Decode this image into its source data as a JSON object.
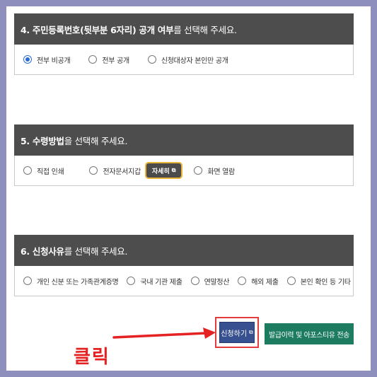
{
  "sections": [
    {
      "title_bold": "4. 주민등록번호(뒷부분 6자리) 공개 여부",
      "title_rest": "를 선택해 주세요.",
      "options": [
        {
          "label": "전부 비공개",
          "checked": true
        },
        {
          "label": "전부 공개",
          "checked": false
        },
        {
          "label": "신청대상자 본인만 공개",
          "checked": false
        }
      ]
    },
    {
      "title_bold": "5. 수령방법",
      "title_rest": "을 선택해 주세요.",
      "options": [
        {
          "label": "직접 인쇄",
          "checked": false
        },
        {
          "label": "전자문서지갑",
          "checked": false
        },
        {
          "label": "화면 열람",
          "checked": false
        }
      ],
      "detail_button": "자세히"
    },
    {
      "title_bold": "6. 신청사유",
      "title_rest": "를 선택해 주세요.",
      "options": [
        {
          "label": "개인 신분 또는 가족관계증명",
          "checked": false
        },
        {
          "label": "국내 기관 제출",
          "checked": false
        },
        {
          "label": "연말정산",
          "checked": false
        },
        {
          "label": "해외 제출",
          "checked": false
        },
        {
          "label": "본인 확인 등 기타",
          "checked": false
        }
      ]
    }
  ],
  "buttons": {
    "apply": "신청하기",
    "issue_history": "발급이력 및 아포스티유 전송"
  },
  "annotation": {
    "click_label": "클릭",
    "color": "#e52222"
  }
}
